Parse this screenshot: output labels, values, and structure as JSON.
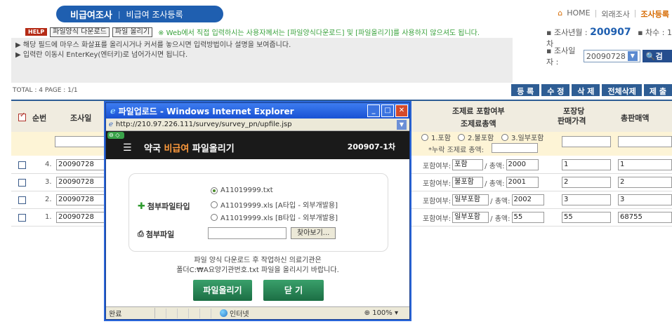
{
  "header": {
    "title": "비급여조사",
    "subtitle": "비급여 조사등록",
    "nav": [
      "HOME",
      "외래조사",
      "조사등록"
    ],
    "home_icon": "home-icon"
  },
  "help": {
    "badge": "HELP",
    "download_btn": "파일양식 다운로드",
    "upload_btn": "파일 올리기",
    "note": "※ Web에서 직접 입력하시는 사용자께서는 [파일양식다운로드] 및 [파일올리기]를 사용하지 않으셔도 됩니다.",
    "lines": [
      "▶ 해당 필드에 마우스 화살표를 올리시거나 커서를 놓으시면 입력방법이나 설명을 보여줍니다.",
      "▶ 입력란 이동시 EnterKey(엔터키)로 넘어가시면 됩니다."
    ]
  },
  "period": {
    "label": "▪ 조사년월 :",
    "value": "200907",
    "round_label": "▪ 차수 : 1차"
  },
  "date_filter": {
    "label": "▪ 조사일자 :",
    "value": "20090728",
    "search_label": "검 색"
  },
  "table": {
    "total": "TOTAL : 4  PAGE : 1/1",
    "actions": [
      "등 록",
      "수 정",
      "삭 제",
      "전체삭제",
      "제 출"
    ],
    "headers": {
      "seq": "순번",
      "date": "조사일",
      "inclusion": "조제료 포함여부",
      "inclusion_total": "조제료총액",
      "unit_price_1": "포장당",
      "unit_price_2": "판매가격",
      "total_sales": "총판매액"
    },
    "filter": {
      "radio_1": "1.포함",
      "radio_2": "2.불포함",
      "radio_3": "3.일부포함",
      "missing": "*누락 조제료 총액:"
    },
    "inclusion_label": "포함여부:",
    "amount_label": "/ 총액:",
    "rows": [
      {
        "no": "4.",
        "date": "20090728",
        "inclusion": "포함",
        "amount": "2000",
        "unit": "1",
        "total": "1"
      },
      {
        "no": "3.",
        "date": "20090728",
        "inclusion": "불포함",
        "amount": "2001",
        "unit": "2",
        "total": "2"
      },
      {
        "no": "2.",
        "date": "20090728",
        "inclusion": "일부포함",
        "amount": "2002",
        "unit": "3",
        "total": "3"
      },
      {
        "no": "1.",
        "date": "20090728",
        "inclusion": "일부포함",
        "amount": "55",
        "unit": "55",
        "total": "68755"
      }
    ]
  },
  "popup": {
    "window_title": "파일업로드 - Windows Internet Explorer",
    "url": "http://210.97.226.111/survey/survey_pn/upfile.jsp",
    "heading_prefix": "약국",
    "heading_highlight": "비급여",
    "heading_suffix": "파일올리기",
    "code": "200907-1차",
    "file_type_label": "첨부파일타입",
    "file_label": "첨부파일",
    "options": [
      "A11019999.txt",
      "A11019999.xls [A타입 - 외부개발용]",
      "A11019999.xls [B타입 - 외부개발용]"
    ],
    "browse": "찾아보기...",
    "notice_1": "파일 양식 다운로드 후 작업하신 의료기관은",
    "notice_2": "폴더C:₩A요양기관번호.txt 파일을 올리시기 바랍니다.",
    "upload_btn": "파일올리기",
    "close_btn": "닫 기",
    "status_done": "완료",
    "status_zone": "인터넷",
    "zoom": "100%"
  },
  "colors": {
    "accent": "#1f5fb0",
    "action": "#2e5d94",
    "popup_title": "#1952d4",
    "green_btn": "#1c6e44"
  }
}
